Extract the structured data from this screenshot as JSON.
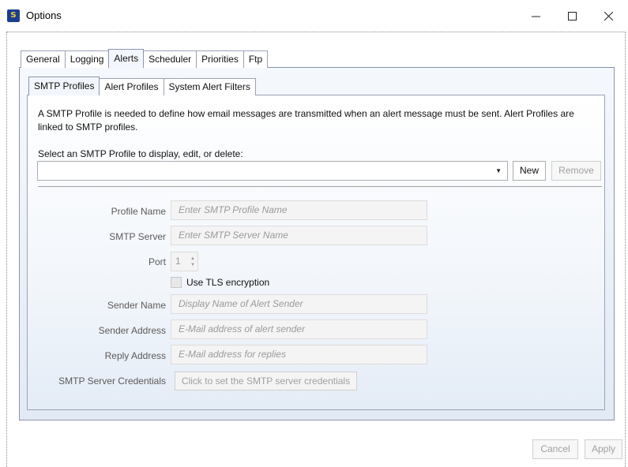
{
  "window": {
    "title": "Options",
    "icon": "app-logo-icon",
    "controls": {
      "minimize": "minimize-icon",
      "maximize": "maximize-icon",
      "close": "close-icon"
    }
  },
  "outer_tabs": [
    {
      "label": "General"
    },
    {
      "label": "Logging"
    },
    {
      "label": "Alerts",
      "active": true
    },
    {
      "label": "Scheduler"
    },
    {
      "label": "Priorities"
    },
    {
      "label": "Ftp"
    }
  ],
  "inner_tabs": [
    {
      "label": "SMTP Profiles",
      "active": true
    },
    {
      "label": "Alert Profiles"
    },
    {
      "label": "System Alert Filters"
    }
  ],
  "smtp": {
    "description": "A SMTP Profile is needed to define how email messages are transmitted when an alert message must be sent. Alert Profiles are linked to SMTP profiles.",
    "select_prompt": "Select an SMTP Profile to display, edit, or delete:",
    "selected_profile": "",
    "new_label": "New",
    "remove_label": "Remove",
    "fields": {
      "profile_name": {
        "label": "Profile Name",
        "placeholder": "Enter SMTP Profile Name"
      },
      "smtp_server": {
        "label": "SMTP Server",
        "placeholder": "Enter SMTP Server Name"
      },
      "port": {
        "label": "Port",
        "value": "1"
      },
      "use_tls": {
        "label": "Use TLS encryption",
        "checked": false
      },
      "sender_name": {
        "label": "Sender Name",
        "placeholder": "Display Name of Alert Sender"
      },
      "sender_address": {
        "label": "Sender Address",
        "placeholder": "E-Mail address of alert sender"
      },
      "reply_address": {
        "label": "Reply Address",
        "placeholder": "E-Mail address for replies"
      },
      "credentials": {
        "label": "SMTP Server Credentials",
        "button": "Click to set the SMTP server credentials"
      }
    }
  },
  "footer": {
    "cancel_label": "Cancel",
    "apply_label": "Apply"
  },
  "colors": {
    "panel_top": "#f5f8fd",
    "panel_bottom": "#e2eaf5",
    "tab_border": "#8a95ab",
    "disabled_text": "#a0a0a0"
  }
}
